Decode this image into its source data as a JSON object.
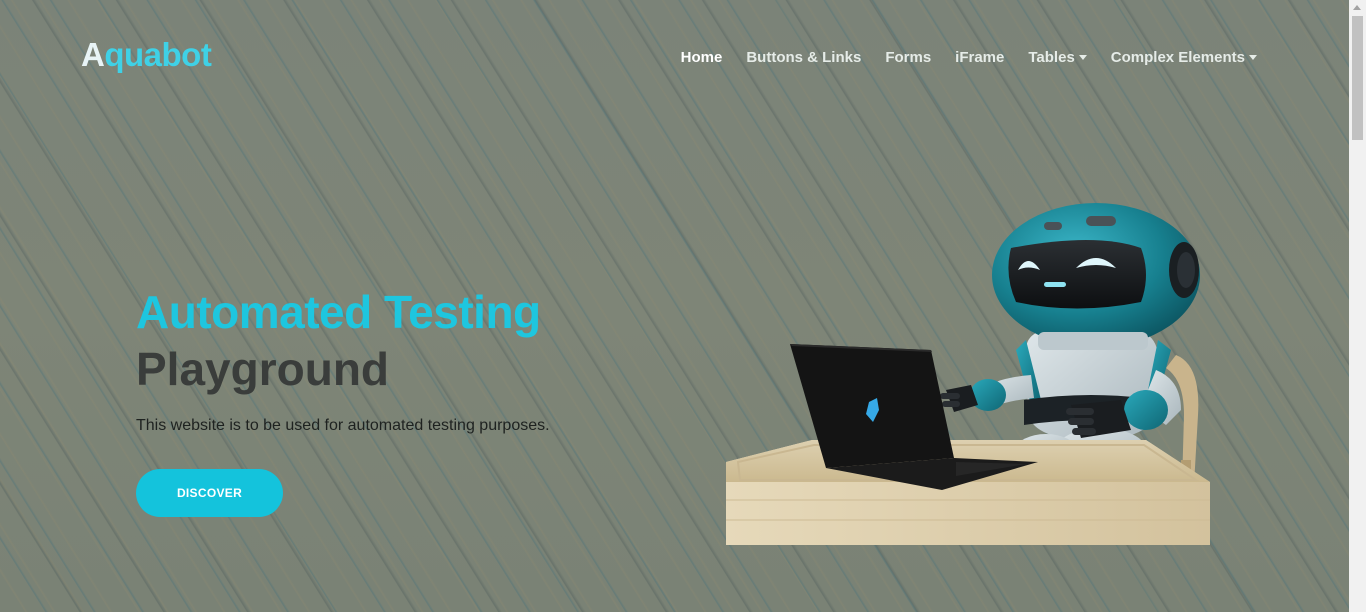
{
  "brand": {
    "first_letter": "A",
    "rest": "quabot"
  },
  "nav": {
    "items": [
      {
        "label": "Home"
      },
      {
        "label": "Buttons & Links"
      },
      {
        "label": "Forms"
      },
      {
        "label": "iFrame"
      },
      {
        "label": "Tables"
      },
      {
        "label": "Complex Elements"
      }
    ]
  },
  "hero": {
    "title_line1": "Automated Testing",
    "title_line2": "Playground",
    "subtitle": "This website is to be used for automated testing purposes.",
    "button_label": "DISCOVER"
  },
  "icons": {
    "dropdown": "chevron-down-icon",
    "illustration": "robot-at-laptop-illustration"
  },
  "colors": {
    "accent": "#14c3dc",
    "title_dark": "#3a3d3b",
    "background": "#7d8577"
  }
}
